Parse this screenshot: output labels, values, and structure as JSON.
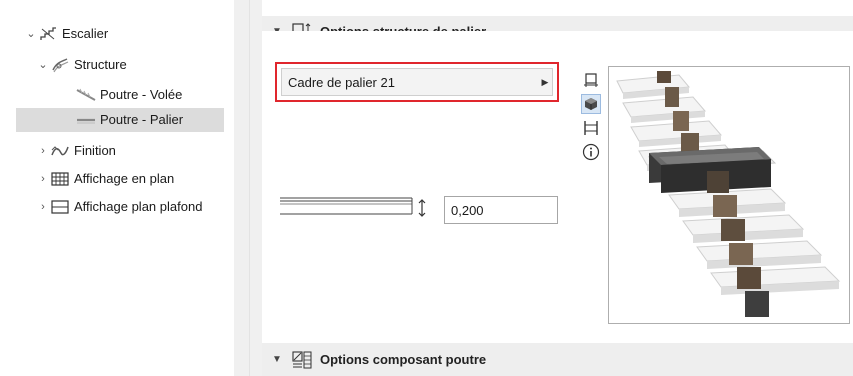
{
  "tree": {
    "items": [
      {
        "label": "Escalier",
        "icon": "stair-icon",
        "expanded": true
      },
      {
        "label": "Structure",
        "icon": "structure-icon",
        "expanded": true
      },
      {
        "label": "Poutre - Volée",
        "icon": "beam-flight-icon"
      },
      {
        "label": "Poutre - Palier",
        "icon": "beam-landing-icon",
        "selected": true
      },
      {
        "label": "Finition",
        "icon": "finish-icon",
        "expanded": false
      },
      {
        "label": "Affichage en plan",
        "icon": "floor-plan-icon",
        "expanded": false
      },
      {
        "label": "Affichage plan plafond",
        "icon": "ceiling-plan-icon",
        "expanded": false
      }
    ]
  },
  "sections": {
    "landing": {
      "title": "Options structure de palier",
      "icon": "landing-structure-icon"
    },
    "beam": {
      "title": "Options composant poutre",
      "icon": "beam-component-icon"
    }
  },
  "landing_frame": {
    "value": "Cadre de palier 21"
  },
  "thickness": {
    "value": "0,200"
  },
  "side_icons": [
    "plan-view-icon",
    "3d-view-icon",
    "section-view-icon",
    "info-icon"
  ],
  "colors": {
    "highlight": "#e0262d",
    "selection": "#dcdcdc",
    "header": "#eeeeee"
  }
}
